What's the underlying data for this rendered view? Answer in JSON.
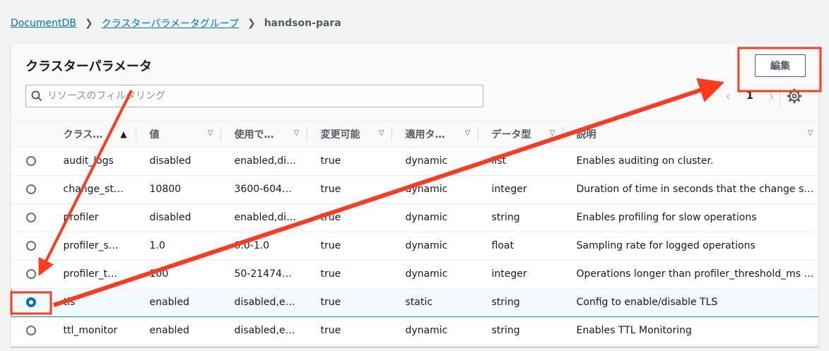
{
  "breadcrumb": {
    "items": [
      "DocumentDB",
      "クラスターパラメータグループ"
    ],
    "current": "handson-para"
  },
  "panel": {
    "title": "クラスターパラメータ",
    "edit_label": "編集",
    "search_placeholder": "リソースのフィルタリング",
    "page_number": "1"
  },
  "table": {
    "columns": [
      "クラス…",
      "値",
      "使用で…",
      "変更可能",
      "適用タ…",
      "データ型",
      "説明"
    ],
    "rows": [
      [
        "audit_logs",
        "disabled",
        "enabled,di…",
        "true",
        "dynamic",
        "list",
        "Enables auditing on cluster."
      ],
      [
        "change_st…",
        "10800",
        "3600-604…",
        "true",
        "dynamic",
        "integer",
        "Duration of time in seconds that the change stre…"
      ],
      [
        "profiler",
        "disabled",
        "enabled,di…",
        "true",
        "dynamic",
        "string",
        "Enables profiling for slow operations"
      ],
      [
        "profiler_s…",
        "1.0",
        "0.0-1.0",
        "true",
        "dynamic",
        "float",
        "Sampling rate for logged operations"
      ],
      [
        "profiler_t…",
        "100",
        "50-21474…",
        "true",
        "dynamic",
        "integer",
        "Operations longer than profiler_threshold_ms w…"
      ],
      [
        "tls",
        "enabled",
        "disabled,e…",
        "true",
        "static",
        "string",
        "Config to enable/disable TLS"
      ],
      [
        "ttl_monitor",
        "enabled",
        "disabled,e…",
        "true",
        "dynamic",
        "string",
        "Enables TTL Monitoring"
      ]
    ],
    "selected_row_index": 5
  },
  "colors": {
    "link": "#0073bb",
    "annotation": "#ff3b1f",
    "selection": "#f1faff"
  },
  "icons": [
    "chevron-right-icon",
    "search-icon",
    "chevron-left-icon",
    "gear-icon",
    "sort-ascending-icon",
    "sort-descending-icon"
  ]
}
